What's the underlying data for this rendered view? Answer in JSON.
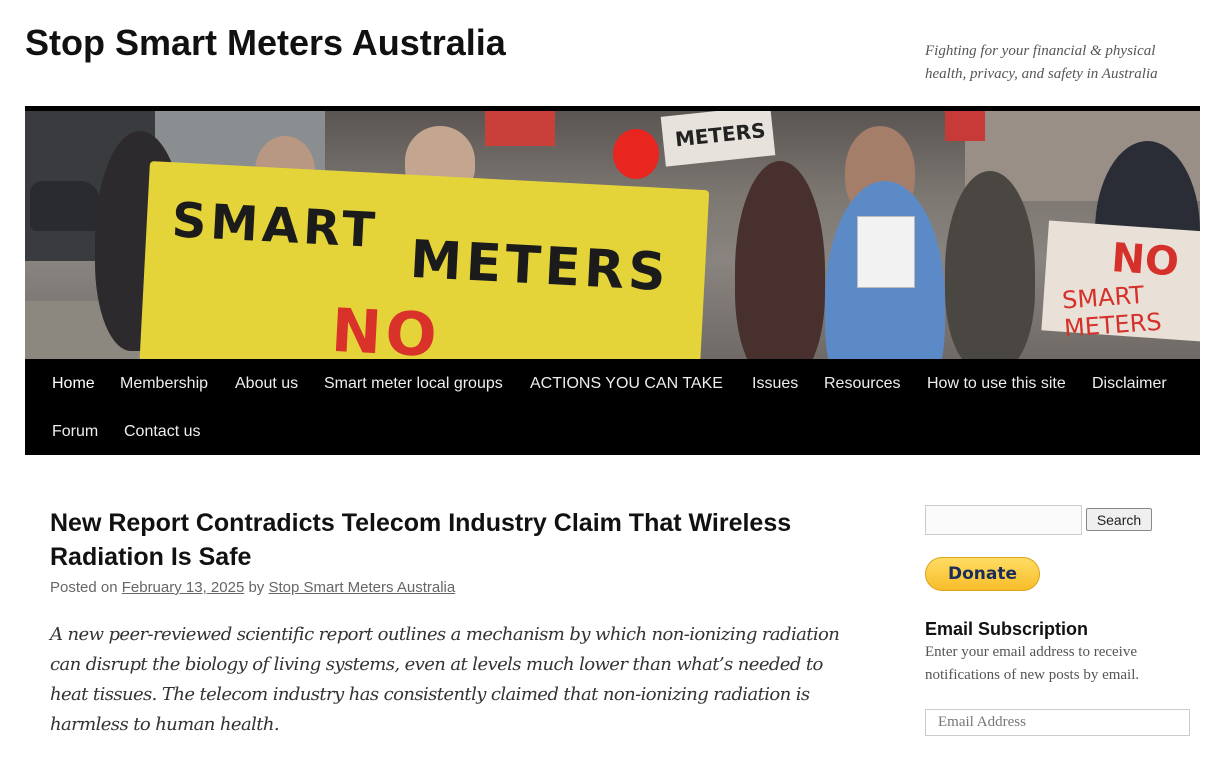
{
  "header": {
    "site_title": "Stop Smart Meters Australia",
    "site_description": "Fighting for your financial & physical health, privacy, and safety in Australia"
  },
  "banner": {
    "banner_words": [
      "SMART",
      "METERS",
      "NO"
    ],
    "sign_top": "METERS",
    "sign_right_top": "NO",
    "sign_right_bottom": "SMART METERS"
  },
  "nav": {
    "items": [
      {
        "label": "Home",
        "active": true
      },
      {
        "label": "Membership"
      },
      {
        "label": "About us"
      },
      {
        "label": "Smart meter local groups"
      },
      {
        "label": "ACTIONS YOU CAN TAKE"
      },
      {
        "label": "Issues"
      },
      {
        "label": "Resources"
      },
      {
        "label": "How to use this site"
      },
      {
        "label": "Disclaimer"
      },
      {
        "label": "Forum"
      },
      {
        "label": "Contact us"
      }
    ]
  },
  "post": {
    "title": "New Report Contradicts Telecom Industry Claim That Wireless Radiation Is Safe",
    "posted_on_label": "Posted on ",
    "date": "February 13, 2025",
    "by_label": " by ",
    "author": "Stop Smart Meters Australia",
    "summary": "A new peer-reviewed scientific report outlines a mechanism by which non-ionizing radiation can disrupt the biology of living systems, even at levels much lower than what’s needed to heat tissues. The telecom industry has consistently claimed that non-ionizing radiation is harmless to human health."
  },
  "sidebar": {
    "search_value": "",
    "search_button": "Search",
    "donate_label": "Donate",
    "email_widget_title": "Email Subscription",
    "email_widget_text": "Enter your email address to receive notifications of new posts by email.",
    "email_placeholder": "Email Address"
  },
  "colors": {
    "menu_bg": "#000000",
    "donate_bg": "#f7bd2a",
    "banner_yellow": "#e4d43a",
    "banner_red": "#d8322a"
  }
}
